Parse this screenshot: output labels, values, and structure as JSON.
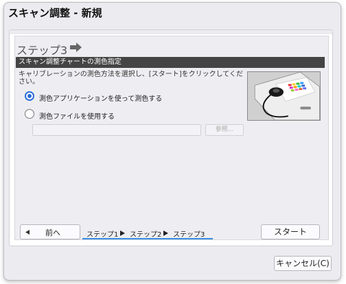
{
  "window": {
    "title": "スキャン調整 - 新規"
  },
  "step": {
    "title": "ステップ3",
    "icon": "arrow-right-icon"
  },
  "section": {
    "header": "スキャン調整チャートの測色指定",
    "description": "キャリブレーションの測色方法を選択し、[スタート]をクリックしてください。"
  },
  "options": {
    "app": {
      "label": "測色アプリケーションを使って測色する",
      "checked": true
    },
    "file": {
      "label": "測色ファイルを使用する",
      "checked": false
    }
  },
  "file_input": {
    "value": "",
    "browse_label": "参照..."
  },
  "navigation": {
    "back_label": "前へ",
    "start_label": "スタート",
    "breadcrumbs": [
      "ステップ1",
      "ステップ2",
      "ステップ3"
    ]
  },
  "footer": {
    "cancel_label": "キャンセル(C)"
  },
  "colors": {
    "accent": "#2c6ed8",
    "progress": "#3a8de0",
    "section_bar": "#444444"
  }
}
